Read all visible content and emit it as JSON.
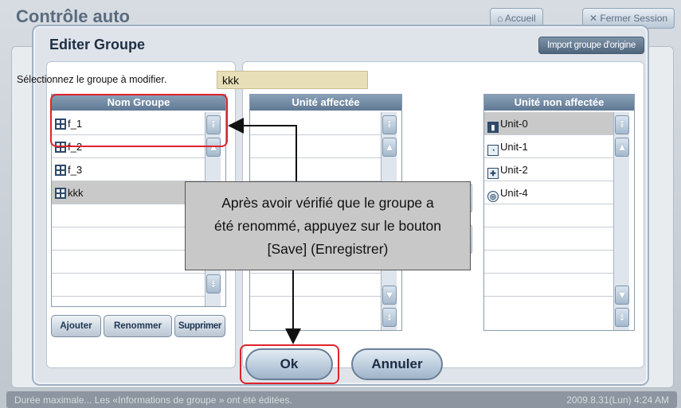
{
  "background": {
    "title": "Contrôle auto",
    "home_label": "Accueil",
    "close_label": "Fermer Session"
  },
  "status_bar": {
    "message": "Durée maximale... Les «Informations de groupe » ont été éditées.",
    "datetime": "2009.8.31(Lun) 4:24 AM"
  },
  "dialog": {
    "title": "Editer Groupe",
    "import_button": "Import groupe d'origine",
    "select_label": "Sélectionnez le groupe à modifier.",
    "group_name_value": "kkk",
    "group_list": {
      "header": "Nom Groupe",
      "items": [
        "f_1",
        "f_2",
        "f_3",
        "kkk"
      ],
      "selected": "kkk"
    },
    "assigned_list": {
      "header": "Unité affectée",
      "items": []
    },
    "unassigned_list": {
      "header": "Unité non affectée",
      "items": [
        {
          "label": "Unit-0",
          "icon": "indoor-unit-icon"
        },
        {
          "label": "Unit-1",
          "icon": "ventilator-icon"
        },
        {
          "label": "Unit-2",
          "icon": "plus-unit-icon"
        },
        {
          "label": "Unit-4",
          "icon": "awhp-icon"
        }
      ],
      "selected": "Unit-0"
    },
    "buttons": {
      "add": "Ajouter",
      "rename": "Renommer",
      "delete": "Supprimer",
      "ok": "Ok",
      "cancel": "Annuler"
    }
  },
  "callout": {
    "line1": "Après avoir vérifié que le groupe a",
    "line2": "été renommé, appuyez sur le bouton",
    "line3": "[Save] (Enregistrer)"
  },
  "colors": {
    "highlight": "#e0232b",
    "header_blue": "#6f88a3",
    "input_bg": "#e8dfb9"
  }
}
